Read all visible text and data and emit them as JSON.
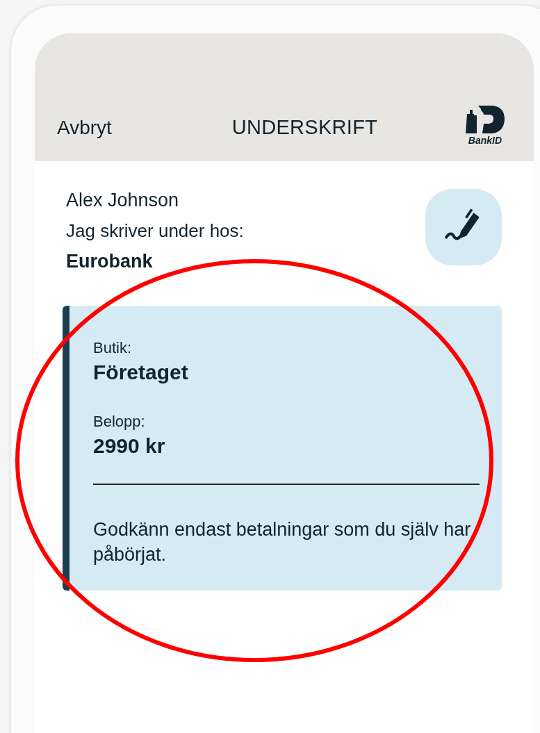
{
  "header": {
    "cancel": "Avbryt",
    "title": "UNDERSKRIFT",
    "logo_text": "BankID"
  },
  "signer": {
    "name": "Alex Johnson",
    "intro": "Jag skriver under hos:",
    "party": "Eurobank"
  },
  "details": {
    "fields": [
      {
        "label": "Butik:",
        "value": "Företaget"
      },
      {
        "label": "Belopp:",
        "value": "2990 kr"
      }
    ],
    "warning": "Godkänn endast betalningar som du själv har påbörjat."
  },
  "annotation": {
    "kind": "ellipse"
  }
}
